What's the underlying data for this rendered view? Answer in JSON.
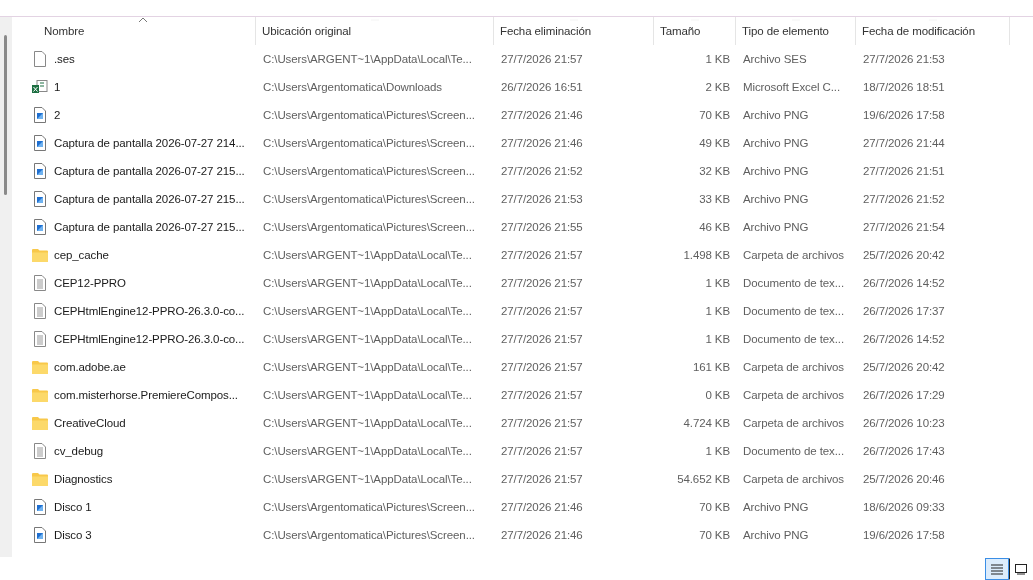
{
  "columns": [
    {
      "label": "Nombre",
      "sorted": true
    },
    {
      "label": "Ubicación original",
      "sorted": false
    },
    {
      "label": "Fecha eliminación",
      "sorted": false
    },
    {
      "label": "Tamaño",
      "sorted": false
    },
    {
      "label": "Tipo de elemento",
      "sorted": false
    },
    {
      "label": "Fecha de modificación",
      "sorted": false
    }
  ],
  "rows": [
    {
      "kind": "blank",
      "name": ".ses",
      "location": "C:\\Users\\ARGENT~1\\AppData\\Local\\Te...",
      "deleted": "27/7/2026 21:57",
      "size": "1 KB",
      "type": "Archivo SES",
      "modified": "27/7/2026 21:53"
    },
    {
      "kind": "excel",
      "name": "1",
      "location": "C:\\Users\\Argentomatica\\Downloads",
      "deleted": "26/7/2026 16:51",
      "size": "2 KB",
      "type": "Microsoft Excel C...",
      "modified": "18/7/2026 18:51"
    },
    {
      "kind": "image",
      "name": "2",
      "location": "C:\\Users\\Argentomatica\\Pictures\\Screen...",
      "deleted": "27/7/2026 21:46",
      "size": "70 KB",
      "type": "Archivo PNG",
      "modified": "19/6/2026 17:58"
    },
    {
      "kind": "image",
      "name": "Captura de pantalla 2026-07-27 214...",
      "location": "C:\\Users\\Argentomatica\\Pictures\\Screen...",
      "deleted": "27/7/2026 21:46",
      "size": "49 KB",
      "type": "Archivo PNG",
      "modified": "27/7/2026 21:44"
    },
    {
      "kind": "image",
      "name": "Captura de pantalla 2026-07-27 215...",
      "location": "C:\\Users\\Argentomatica\\Pictures\\Screen...",
      "deleted": "27/7/2026 21:52",
      "size": "32 KB",
      "type": "Archivo PNG",
      "modified": "27/7/2026 21:51"
    },
    {
      "kind": "image",
      "name": "Captura de pantalla 2026-07-27 215...",
      "location": "C:\\Users\\Argentomatica\\Pictures\\Screen...",
      "deleted": "27/7/2026 21:53",
      "size": "33 KB",
      "type": "Archivo PNG",
      "modified": "27/7/2026 21:52"
    },
    {
      "kind": "image",
      "name": "Captura de pantalla 2026-07-27 215...",
      "location": "C:\\Users\\Argentomatica\\Pictures\\Screen...",
      "deleted": "27/7/2026 21:55",
      "size": "46 KB",
      "type": "Archivo PNG",
      "modified": "27/7/2026 21:54"
    },
    {
      "kind": "folder",
      "name": "cep_cache",
      "location": "C:\\Users\\ARGENT~1\\AppData\\Local\\Te...",
      "deleted": "27/7/2026 21:57",
      "size": "1.498 KB",
      "type": "Carpeta de archivos",
      "modified": "25/7/2026 20:42"
    },
    {
      "kind": "text",
      "name": "CEP12-PPRO",
      "location": "C:\\Users\\ARGENT~1\\AppData\\Local\\Te...",
      "deleted": "27/7/2026 21:57",
      "size": "1 KB",
      "type": "Documento de tex...",
      "modified": "26/7/2026 14:52"
    },
    {
      "kind": "text",
      "name": "CEPHtmlEngine12-PPRO-26.3.0-co...",
      "location": "C:\\Users\\ARGENT~1\\AppData\\Local\\Te...",
      "deleted": "27/7/2026 21:57",
      "size": "1 KB",
      "type": "Documento de tex...",
      "modified": "26/7/2026 17:37"
    },
    {
      "kind": "text",
      "name": "CEPHtmlEngine12-PPRO-26.3.0-co...",
      "location": "C:\\Users\\ARGENT~1\\AppData\\Local\\Te...",
      "deleted": "27/7/2026 21:57",
      "size": "1 KB",
      "type": "Documento de tex...",
      "modified": "26/7/2026 14:52"
    },
    {
      "kind": "folder",
      "name": "com.adobe.ae",
      "location": "C:\\Users\\ARGENT~1\\AppData\\Local\\Te...",
      "deleted": "27/7/2026 21:57",
      "size": "161 KB",
      "type": "Carpeta de archivos",
      "modified": "25/7/2026 20:42"
    },
    {
      "kind": "folder",
      "name": "com.misterhorse.PremiereCompos...",
      "location": "C:\\Users\\ARGENT~1\\AppData\\Local\\Te...",
      "deleted": "27/7/2026 21:57",
      "size": "0 KB",
      "type": "Carpeta de archivos",
      "modified": "26/7/2026 17:29"
    },
    {
      "kind": "folder",
      "name": "CreativeCloud",
      "location": "C:\\Users\\ARGENT~1\\AppData\\Local\\Te...",
      "deleted": "27/7/2026 21:57",
      "size": "4.724 KB",
      "type": "Carpeta de archivos",
      "modified": "26/7/2026 10:23"
    },
    {
      "kind": "text",
      "name": "cv_debug",
      "location": "C:\\Users\\ARGENT~1\\AppData\\Local\\Te...",
      "deleted": "27/7/2026 21:57",
      "size": "1 KB",
      "type": "Documento de tex...",
      "modified": "26/7/2026 17:43"
    },
    {
      "kind": "folder",
      "name": "Diagnostics",
      "location": "C:\\Users\\ARGENT~1\\AppData\\Local\\Te...",
      "deleted": "27/7/2026 21:57",
      "size": "54.652 KB",
      "type": "Carpeta de archivos",
      "modified": "25/7/2026 20:46"
    },
    {
      "kind": "image",
      "name": "Disco 1",
      "location": "C:\\Users\\Argentomatica\\Pictures\\Screen...",
      "deleted": "27/7/2026 21:46",
      "size": "70 KB",
      "type": "Archivo PNG",
      "modified": "18/6/2026 09:33"
    },
    {
      "kind": "image",
      "name": "Disco 3",
      "location": "C:\\Users\\Argentomatica\\Pictures\\Screen...",
      "deleted": "27/7/2026 21:46",
      "size": "70 KB",
      "type": "Archivo PNG",
      "modified": "19/6/2026 17:58"
    }
  ],
  "view_buttons": [
    {
      "kind": "details",
      "selected": true
    },
    {
      "kind": "tiles",
      "selected": false
    }
  ]
}
